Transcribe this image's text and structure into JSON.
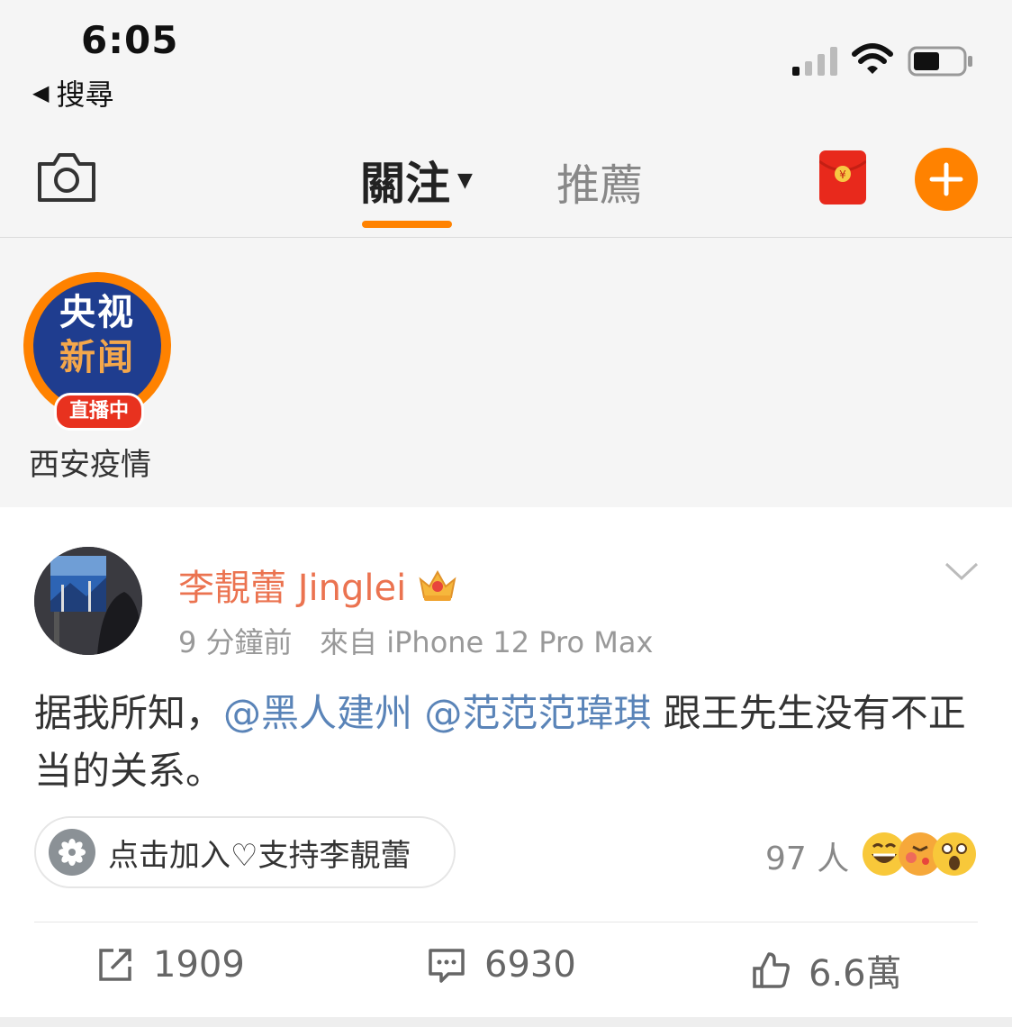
{
  "status_bar": {
    "time": "6:05",
    "back_label": "搜尋"
  },
  "nav": {
    "tab_follow": "關注",
    "tab_recommend": "推薦",
    "accent_color": "#ff8200"
  },
  "stories": [
    {
      "logo_line1": "央视",
      "logo_line2": "新闻",
      "live_badge": "直播中",
      "label": "西安疫情"
    }
  ],
  "post": {
    "author": "李靚蕾 Jinglei",
    "author_color": "#eb7350",
    "meta": "9 分鐘前   來自 iPhone 12 Pro Max",
    "body_prefix": "据我所知，",
    "mention1": "@黑人建州",
    "mention2": "@范范范瑋琪",
    "body_suffix": " 跟王先生没有不正当的关系。",
    "mention_color": "#5a84b8",
    "support_label": "点击加入♡支持李靚蕾",
    "reactors": "97 人",
    "repost_count": "1909",
    "comment_count": "6930",
    "like_count": "6.6萬"
  }
}
